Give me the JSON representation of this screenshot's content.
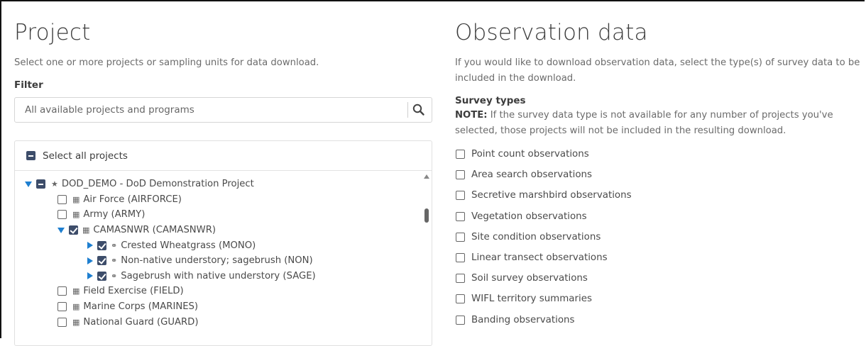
{
  "project": {
    "title": "Project",
    "intro": "Select one or more projects or sampling units for data download.",
    "filter_label": "Filter",
    "filter_placeholder": "All available projects and programs",
    "select_all_label": "Select all projects",
    "tree": [
      {
        "label": "DOD_DEMO - DoD Demonstration Project",
        "level": 0,
        "expander": "down",
        "state": "partial",
        "icon": "star-icon"
      },
      {
        "label": "Air Force (AIRFORCE)",
        "level": 1,
        "expander": "none",
        "state": "unchecked",
        "icon": "grid-icon"
      },
      {
        "label": "Army (ARMY)",
        "level": 1,
        "expander": "none",
        "state": "unchecked",
        "icon": "grid-icon"
      },
      {
        "label": "CAMASNWR (CAMASNWR)",
        "level": 1,
        "expander": "down",
        "state": "checked",
        "icon": "grid-icon"
      },
      {
        "label": "Crested Wheatgrass (MONO)",
        "level": 2,
        "expander": "right",
        "state": "checked",
        "icon": "link-icon"
      },
      {
        "label": "Non-native understory; sagebrush (NON)",
        "level": 2,
        "expander": "right",
        "state": "checked",
        "icon": "link-icon"
      },
      {
        "label": "Sagebrush with native understory (SAGE)",
        "level": 2,
        "expander": "right",
        "state": "checked",
        "icon": "link-icon"
      },
      {
        "label": "Field Exercise (FIELD)",
        "level": 1,
        "expander": "none",
        "state": "unchecked",
        "icon": "grid-icon"
      },
      {
        "label": "Marine Corps (MARINES)",
        "level": 1,
        "expander": "none",
        "state": "unchecked",
        "icon": "grid-icon"
      },
      {
        "label": "National Guard (GUARD)",
        "level": 1,
        "expander": "none",
        "state": "unchecked",
        "icon": "grid-icon"
      }
    ]
  },
  "observation": {
    "title": "Observation data",
    "intro": "If you would like to download observation data, select the type(s) of survey data to be included in the download.",
    "survey_types_label": "Survey types",
    "note_prefix": "NOTE:",
    "note_text": " If the survey data type is not available for any number of projects you've selected, those projects will not be included in the resulting download.",
    "options": [
      "Point count observations",
      "Area search observations",
      "Secretive marshbird observations",
      "Vegetation observations",
      "Site condition observations",
      "Linear transect observations",
      "Soil survey observations",
      "WIFL territory summaries",
      "Banding observations"
    ]
  },
  "colors": {
    "accent_blue": "#1e7fd0",
    "checkbox_fill": "#3d4d6a"
  }
}
